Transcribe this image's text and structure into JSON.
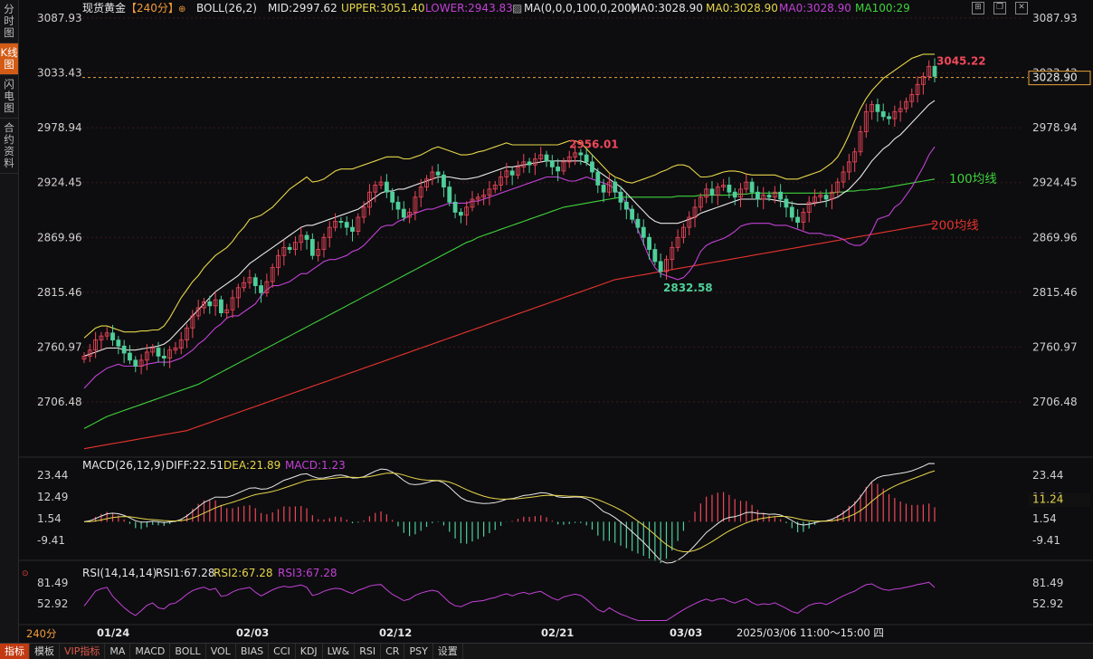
{
  "sidebar": {
    "tabs": [
      {
        "label": "分时图",
        "active": false
      },
      {
        "label": "K线图",
        "active": true
      },
      {
        "label": "闪电图",
        "active": false
      },
      {
        "label": "合约资料",
        "active": false
      }
    ]
  },
  "header": {
    "symbol": "现货黄金",
    "period": "【240分】",
    "boll": "BOLL(26,2)",
    "mid": "MID:2997.62",
    "upper": "UPPER:3051.40",
    "lower": "LOWER:2943.83",
    "ma": "MA(0,0,0,100,0,200)",
    "ma_a": "MA0:3028.90",
    "ma_b": "MA0:3028.90",
    "ma_c": "MA0:3028.90",
    "ma100": "MA100:29"
  },
  "colors": {
    "up": "#f0475a",
    "down": "#4fcf9a",
    "mid": "#e8e8e8",
    "upper": "#e6d64a",
    "lower": "#c241d6",
    "ma100": "#3fd23c",
    "ma200": "#e8332e",
    "grid": "#3a1a1a"
  },
  "chart_data": [
    {
      "type": "candlestick",
      "title": "现货黄金 240分",
      "ylim": [
        2640,
        3100
      ],
      "yticks": [
        "3087.93",
        "3033.43",
        "2978.94",
        "2924.45",
        "2869.96",
        "2815.46",
        "2760.97",
        "2706.48"
      ],
      "xticks": [
        "01/24",
        "02/03",
        "02/12",
        "02/21",
        "03/03"
      ],
      "current_price": "3028.90",
      "annotations": {
        "high1": "2956.01",
        "low": "2832.58",
        "high2": "3045.22",
        "ma100_label": "100均线",
        "ma200_label": "200均线"
      },
      "closes": [
        2752,
        2758,
        2768,
        2772,
        2775,
        2768,
        2762,
        2755,
        2748,
        2742,
        2748,
        2756,
        2760,
        2752,
        2750,
        2758,
        2760,
        2768,
        2780,
        2792,
        2800,
        2806,
        2802,
        2808,
        2795,
        2798,
        2810,
        2820,
        2825,
        2830,
        2822,
        2815,
        2826,
        2840,
        2852,
        2860,
        2858,
        2865,
        2872,
        2868,
        2852,
        2858,
        2870,
        2880,
        2886,
        2885,
        2880,
        2876,
        2890,
        2900,
        2915,
        2922,
        2925,
        2915,
        2905,
        2898,
        2890,
        2895,
        2910,
        2920,
        2928,
        2935,
        2932,
        2920,
        2905,
        2895,
        2892,
        2900,
        2908,
        2910,
        2912,
        2918,
        2922,
        2930,
        2936,
        2932,
        2940,
        2945,
        2942,
        2948,
        2952,
        2946,
        2940,
        2936,
        2945,
        2950,
        2954,
        2952,
        2945,
        2935,
        2922,
        2915,
        2925,
        2915,
        2905,
        2898,
        2888,
        2880,
        2870,
        2858,
        2846,
        2836,
        2848,
        2860,
        2870,
        2880,
        2890,
        2900,
        2910,
        2918,
        2912,
        2920,
        2922,
        2915,
        2910,
        2918,
        2925,
        2915,
        2908,
        2912,
        2910,
        2915,
        2908,
        2900,
        2890,
        2885,
        2895,
        2905,
        2910,
        2912,
        2908,
        2915,
        2925,
        2935,
        2945,
        2955,
        2975,
        2995,
        3002,
        2995,
        2990,
        2988,
        2995,
        2998,
        3005,
        3012,
        3022,
        3030,
        3040,
        3030
      ],
      "mid_line": [
        2752,
        2754,
        2756,
        2758,
        2760,
        2760,
        2760,
        2758,
        2758,
        2758,
        2759,
        2760,
        2761,
        2762,
        2764,
        2768,
        2774,
        2780,
        2786,
        2792,
        2798,
        2804,
        2810,
        2816,
        2820,
        2824,
        2828,
        2832,
        2838,
        2844,
        2848,
        2852,
        2856,
        2860,
        2864,
        2868,
        2872,
        2876,
        2880,
        2882,
        2882,
        2884,
        2886,
        2888,
        2890,
        2892,
        2894,
        2896,
        2898,
        2902,
        2906,
        2910,
        2914,
        2916,
        2916,
        2918,
        2918,
        2920,
        2922,
        2924,
        2926,
        2928,
        2930,
        2930,
        2930,
        2929,
        2928,
        2928,
        2929,
        2930,
        2932,
        2934,
        2936,
        2938,
        2940,
        2940,
        2941,
        2942,
        2943,
        2944,
        2945,
        2946,
        2946,
        2946,
        2946,
        2946,
        2946,
        2946,
        2944,
        2940,
        2936,
        2932,
        2928,
        2924,
        2920,
        2914,
        2908,
        2902,
        2896,
        2890,
        2886,
        2884,
        2884,
        2884,
        2884,
        2886,
        2888,
        2890,
        2894,
        2896,
        2898,
        2900,
        2902,
        2904,
        2906,
        2908,
        2908,
        2908,
        2908,
        2908,
        2908,
        2907,
        2906,
        2905,
        2904,
        2903,
        2903,
        2903,
        2904,
        2905,
        2906,
        2908,
        2910,
        2914,
        2918,
        2924,
        2930,
        2938,
        2946,
        2952,
        2958,
        2962,
        2968,
        2972,
        2978,
        2984,
        2990,
        2996,
        3002,
        3006
      ],
      "upper_line": [
        2770,
        2775,
        2780,
        2782,
        2782,
        2780,
        2778,
        2776,
        2776,
        2776,
        2777,
        2777,
        2778,
        2778,
        2782,
        2790,
        2800,
        2810,
        2818,
        2826,
        2832,
        2840,
        2846,
        2852,
        2856,
        2860,
        2866,
        2874,
        2880,
        2888,
        2890,
        2892,
        2896,
        2900,
        2906,
        2912,
        2918,
        2922,
        2926,
        2930,
        2925,
        2926,
        2928,
        2932,
        2936,
        2938,
        2938,
        2938,
        2940,
        2942,
        2944,
        2946,
        2948,
        2950,
        2950,
        2950,
        2948,
        2948,
        2950,
        2952,
        2955,
        2958,
        2960,
        2958,
        2956,
        2954,
        2952,
        2952,
        2953,
        2955,
        2956,
        2958,
        2960,
        2962,
        2964,
        2962,
        2962,
        2962,
        2962,
        2962,
        2962,
        2962,
        2962,
        2962,
        2964,
        2966,
        2966,
        2964,
        2958,
        2952,
        2946,
        2940,
        2934,
        2930,
        2928,
        2925,
        2924,
        2926,
        2928,
        2930,
        2932,
        2935,
        2937,
        2940,
        2942,
        2942,
        2940,
        2935,
        2930,
        2930,
        2931,
        2933,
        2935,
        2936,
        2936,
        2935,
        2933,
        2932,
        2932,
        2932,
        2932,
        2932,
        2930,
        2928,
        2928,
        2928,
        2930,
        2932,
        2934,
        2936,
        2940,
        2944,
        2950,
        2960,
        2972,
        2986,
        2998,
        3008,
        3016,
        3022,
        3028,
        3032,
        3036,
        3040,
        3044,
        3048,
        3050,
        3052,
        3052,
        3052
      ],
      "lower_line": [
        2720,
        2726,
        2732,
        2736,
        2740,
        2742,
        2744,
        2742,
        2742,
        2742,
        2742,
        2744,
        2745,
        2746,
        2746,
        2746,
        2748,
        2750,
        2754,
        2758,
        2764,
        2768,
        2774,
        2780,
        2784,
        2790,
        2792,
        2792,
        2796,
        2800,
        2804,
        2812,
        2818,
        2822,
        2822,
        2824,
        2826,
        2830,
        2834,
        2834,
        2838,
        2842,
        2846,
        2848,
        2848,
        2850,
        2852,
        2856,
        2858,
        2862,
        2868,
        2874,
        2880,
        2882,
        2882,
        2886,
        2888,
        2892,
        2894,
        2896,
        2898,
        2898,
        2900,
        2902,
        2904,
        2904,
        2904,
        2904,
        2906,
        2906,
        2908,
        2910,
        2912,
        2914,
        2916,
        2918,
        2920,
        2922,
        2924,
        2926,
        2928,
        2930,
        2930,
        2930,
        2928,
        2926,
        2926,
        2928,
        2930,
        2928,
        2926,
        2924,
        2922,
        2918,
        2912,
        2904,
        2892,
        2878,
        2864,
        2850,
        2840,
        2834,
        2832,
        2830,
        2828,
        2830,
        2836,
        2844,
        2856,
        2862,
        2865,
        2867,
        2869,
        2872,
        2876,
        2881,
        2883,
        2884,
        2884,
        2884,
        2884,
        2882,
        2882,
        2882,
        2880,
        2878,
        2876,
        2874,
        2874,
        2874,
        2872,
        2872,
        2870,
        2868,
        2864,
        2862,
        2862,
        2866,
        2876,
        2888,
        2890,
        2892,
        2900,
        2904,
        2912,
        2920,
        2930,
        2940,
        2952,
        2960
      ],
      "ma100": [
        2680,
        2683,
        2686,
        2689,
        2692,
        2694,
        2696,
        2698,
        2700,
        2702,
        2704,
        2706,
        2708,
        2710,
        2712,
        2714,
        2716,
        2718,
        2720,
        2722,
        2724,
        2727,
        2730,
        2733,
        2736,
        2739,
        2742,
        2745,
        2748,
        2751,
        2754,
        2757,
        2760,
        2763,
        2766,
        2769,
        2772,
        2775,
        2778,
        2781,
        2784,
        2787,
        2790,
        2793,
        2796,
        2799,
        2802,
        2805,
        2808,
        2811,
        2814,
        2817,
        2820,
        2823,
        2826,
        2829,
        2832,
        2835,
        2838,
        2841,
        2844,
        2847,
        2850,
        2853,
        2856,
        2859,
        2862,
        2865,
        2867,
        2870,
        2872,
        2874,
        2876,
        2878,
        2880,
        2882,
        2884,
        2886,
        2888,
        2890,
        2892,
        2894,
        2896,
        2898,
        2900,
        2901,
        2902,
        2903,
        2904,
        2905,
        2906,
        2907,
        2908,
        2909,
        2910,
        2910,
        2910,
        2910,
        2910,
        2910,
        2910,
        2910,
        2910,
        2910,
        2911,
        2911,
        2911,
        2911,
        2912,
        2912,
        2912,
        2912,
        2912,
        2912,
        2913,
        2913,
        2913,
        2914,
        2914,
        2914,
        2914,
        2914,
        2914,
        2914,
        2914,
        2914,
        2914,
        2914,
        2914,
        2914,
        2914,
        2914,
        2915,
        2915,
        2916,
        2916,
        2917,
        2917,
        2918,
        2918,
        2919,
        2920,
        2921,
        2922,
        2923,
        2924,
        2925,
        2926,
        2927,
        2928
      ],
      "ma200": [
        2660,
        2661,
        2662,
        2663,
        2664,
        2665,
        2666,
        2667,
        2668,
        2669,
        2670,
        2671,
        2672,
        2673,
        2674,
        2675,
        2676,
        2677,
        2678,
        2680,
        2682,
        2684,
        2686,
        2688,
        2690,
        2692,
        2694,
        2696,
        2698,
        2700,
        2702,
        2704,
        2706,
        2708,
        2710,
        2712,
        2714,
        2716,
        2718,
        2720,
        2722,
        2724,
        2726,
        2728,
        2730,
        2732,
        2734,
        2736,
        2738,
        2740,
        2742,
        2744,
        2746,
        2748,
        2750,
        2752,
        2754,
        2756,
        2758,
        2760,
        2762,
        2764,
        2766,
        2768,
        2770,
        2772,
        2774,
        2776,
        2778,
        2780,
        2782,
        2784,
        2786,
        2788,
        2790,
        2792,
        2794,
        2796,
        2798,
        2800,
        2802,
        2804,
        2806,
        2808,
        2810,
        2812,
        2814,
        2816,
        2818,
        2820,
        2822,
        2824,
        2826,
        2828,
        2829,
        2830,
        2831,
        2832,
        2833,
        2834,
        2835,
        2836,
        2837,
        2838,
        2839,
        2840,
        2841,
        2842,
        2843,
        2844,
        2845,
        2846,
        2847,
        2848,
        2849,
        2850,
        2851,
        2852,
        2853,
        2854,
        2855,
        2856,
        2857,
        2858,
        2859,
        2860,
        2861,
        2862,
        2863,
        2864,
        2865,
        2866,
        2867,
        2868,
        2869,
        2870,
        2871,
        2872,
        2873,
        2874,
        2875,
        2876,
        2877,
        2878,
        2879,
        2880,
        2881,
        2882,
        2883,
        2884
      ]
    },
    {
      "type": "macd",
      "title": "MACD(26,12,9)",
      "diff": "DIFF:22.51",
      "dea": "DEA:21.89",
      "macd": "MACD:1.23",
      "yticks": [
        "23.44",
        "12.49",
        "1.54",
        "-9.41"
      ],
      "current": "11.24",
      "ylim": [
        -20,
        30
      ]
    },
    {
      "type": "rsi",
      "title": "RSI(14,14,14)",
      "rsi1": "RSI1:67.28",
      "rsi2": "RSI2:67.28",
      "rsi3": "RSI3:67.28",
      "yticks": [
        "81.49",
        "52.92"
      ],
      "ylim": [
        30,
        95
      ]
    }
  ],
  "footer": {
    "period": "240分",
    "range": "2025/03/06 11:00～15:00 四"
  },
  "bottom_bar": [
    "指标",
    "模板",
    "VIP指标",
    "MA",
    "MACD",
    "BOLL",
    "VOL",
    "BIAS",
    "CCI",
    "KDJ",
    "LW&",
    "RSI",
    "CR",
    "PSY",
    "设置"
  ]
}
